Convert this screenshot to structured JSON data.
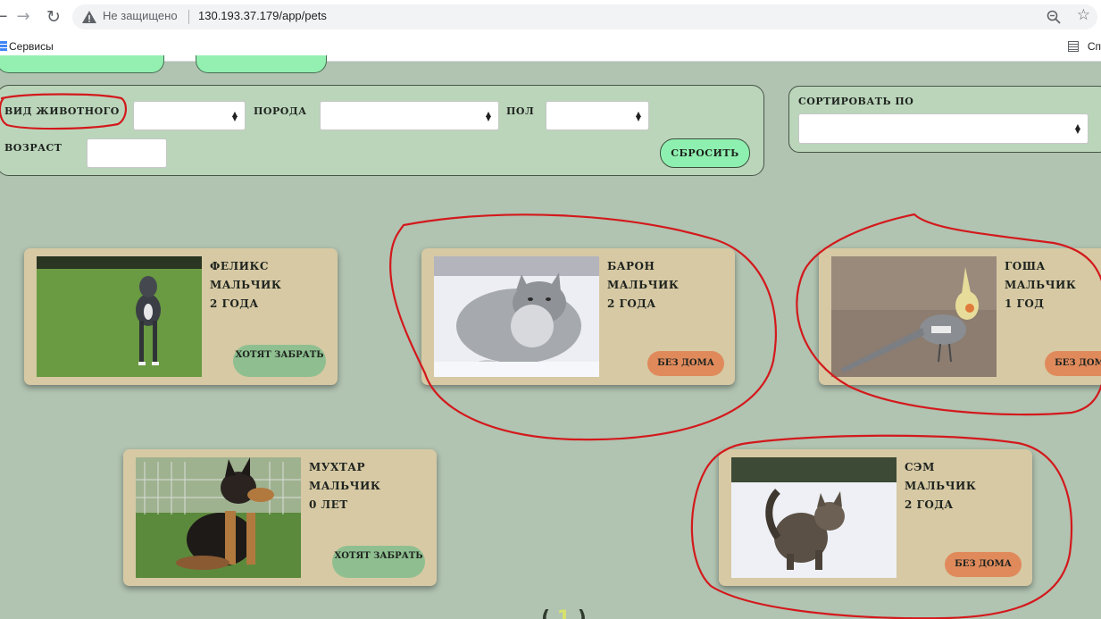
{
  "browser": {
    "security_text": "Не защищено",
    "url": "130.193.37.179/app/pets",
    "bookmarks_label": "Сервисы",
    "right_bookmark_label": "Сп"
  },
  "filters": {
    "species_label": "Вид животного",
    "breed_label": "порода",
    "sex_label": "пол",
    "age_label": "возраст",
    "reset_label": "Сбросить",
    "sort_label": "Сортировать по"
  },
  "pets": [
    {
      "name": "Феликс",
      "sex": "мальчик",
      "age": "2 года",
      "status": "хотят забрать",
      "status_kind": "want",
      "photo": "dog-pitbull"
    },
    {
      "name": "Барон",
      "sex": "мальчик",
      "age": "2 года",
      "status": "без дома",
      "status_kind": "homeless",
      "photo": "cat-gray"
    },
    {
      "name": "Гоша",
      "sex": "мальчик",
      "age": "1 год",
      "status": "без дома",
      "status_kind": "homeless",
      "photo": "parrot-cockatiel"
    },
    {
      "name": "Мухтар",
      "sex": "мальчик",
      "age": "0 лет",
      "status": "хотят забрать",
      "status_kind": "want",
      "photo": "dog-shepherd-puppy"
    },
    {
      "name": "Сэм",
      "sex": "мальчик",
      "age": "2 года",
      "status": "без дома",
      "status_kind": "homeless",
      "photo": "cat-tabby-snow"
    }
  ],
  "pagination": {
    "current": "1"
  },
  "colors": {
    "page_bg": "#b1c3b1",
    "panel_bg": "#bbd5bb",
    "card_bg": "#d6c9a4",
    "want_badge": "#8fbf90",
    "homeless_badge": "#e08a5c",
    "reset_button": "#8ef0b0",
    "annotation_red": "#d3191c"
  }
}
